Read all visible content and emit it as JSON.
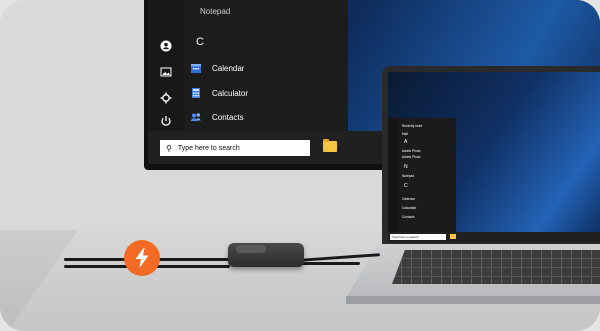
{
  "monitor": {
    "start_menu": {
      "partial_top_item": "Notepad",
      "section_letter": "C",
      "items": [
        {
          "label": "Calendar",
          "icon": "calendar-icon"
        },
        {
          "label": "Calculator",
          "icon": "calculator-icon"
        },
        {
          "label": "Contacts",
          "icon": "contacts-icon"
        }
      ],
      "rail_icons": [
        "user-icon",
        "pictures-icon",
        "settings-icon",
        "power-icon"
      ]
    },
    "taskbar": {
      "search_placeholder": "Type here to search",
      "pinned": [
        "file-explorer-icon"
      ]
    }
  },
  "laptop": {
    "start_menu": {
      "recent_header": "Recently used",
      "items": [
        {
          "letter": "",
          "label": "Mail"
        },
        {
          "letter": "A",
          "label": "Adobe Photo"
        },
        {
          "letter": "",
          "label": "Adobe Photo"
        },
        {
          "letter": "N",
          "label": "Notepad"
        },
        {
          "letter": "C",
          "label": "Calendar"
        },
        {
          "letter": "",
          "label": "Calculator"
        },
        {
          "letter": "",
          "label": "Contacts"
        }
      ]
    },
    "taskbar": {
      "search_placeholder": "Type here to search"
    }
  },
  "colors": {
    "accent_orange": "#f26a24",
    "wallpaper_blue": "#1e5aa6",
    "taskbar": "#202020"
  },
  "badges": {
    "power_icon": "lightning-bolt-icon"
  }
}
